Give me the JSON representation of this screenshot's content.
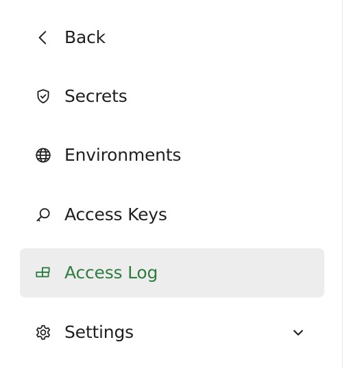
{
  "sidebar": {
    "accent_color": "#2c7d3f",
    "active_bg": "#ededed",
    "items": [
      {
        "label": "Back",
        "icon": "chevron-left-icon"
      },
      {
        "label": "Secrets",
        "icon": "shield-check-icon"
      },
      {
        "label": "Environments",
        "icon": "globe-icon"
      },
      {
        "label": "Access Keys",
        "icon": "key-search-icon"
      },
      {
        "label": "Access Log",
        "icon": "log-blocks-icon",
        "active": true
      },
      {
        "label": "Settings",
        "icon": "gear-icon",
        "expandable": true
      }
    ]
  }
}
